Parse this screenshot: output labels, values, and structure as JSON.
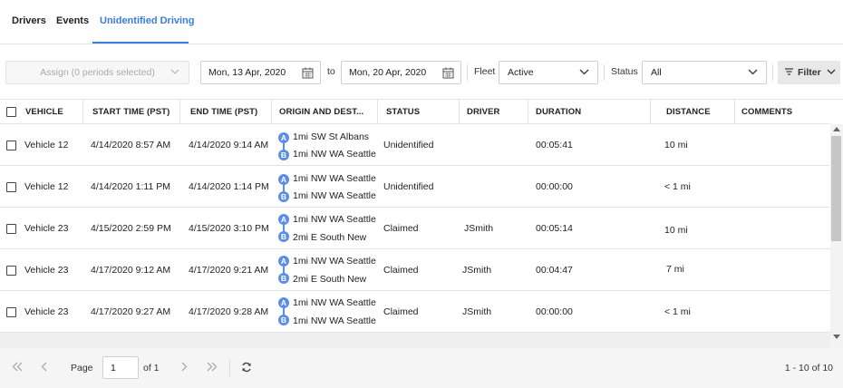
{
  "tabs": [
    {
      "label": "Drivers",
      "active": false
    },
    {
      "label": "Events",
      "active": false
    },
    {
      "label": "Unidentified Driving",
      "active": true
    }
  ],
  "toolbar": {
    "assign_label": "Assign (0 periods selected)",
    "start_date": "Mon, 13 Apr, 2020",
    "to_label": "to",
    "end_date": "Mon, 20 Apr, 2020",
    "fleet_label": "Fleet",
    "fleet_value": "Active",
    "status_label": "Status",
    "status_value": "All",
    "filter_label": "Filter"
  },
  "table": {
    "columns": [
      "VEHICLE",
      "START TIME (PST)",
      "END TIME (PST)",
      "ORIGIN AND DEST...",
      "STATUS",
      "DRIVER",
      "DURATION",
      "DISTANCE",
      "COMMENTS"
    ],
    "rows": [
      {
        "vehicle": "Vehicle 12",
        "start": "4/14/2020 8:57 AM",
        "end": "4/14/2020 9:14 AM",
        "origin": "1mi SW St Albans",
        "dest": "1mi NW WA Seattle",
        "status": "Unidentified",
        "driver": "",
        "duration": "00:05:41",
        "distance": "10 mi",
        "comments": ""
      },
      {
        "vehicle": "Vehicle 12",
        "start": "4/14/2020 1:11 PM",
        "end": "4/14/2020 1:14 PM",
        "origin": "1mi NW WA Seattle",
        "dest": "1mi NW WA Seattle",
        "status": "Unidentified",
        "driver": "",
        "duration": "00:00:00",
        "distance": "< 1 mi",
        "comments": ""
      },
      {
        "vehicle": "Vehicle 23",
        "start": "4/15/2020 2:59 PM",
        "end": "4/15/2020 3:10 PM",
        "origin": "1mi NW WA Seattle",
        "dest": "2mi E South New",
        "status": "Claimed",
        "driver": "JSmith",
        "duration": "00:05:14",
        "distance": "10 mi",
        "comments": ""
      },
      {
        "vehicle": "Vehicle 23",
        "start": "4/17/2020 9:12 AM",
        "end": "4/17/2020 9:21 AM",
        "origin": "1mi NW WA Seattle",
        "dest": "2mi E South New",
        "status": "Claimed",
        "driver": "JSmith",
        "duration": "00:04:47",
        "distance": "7 mi",
        "comments": ""
      },
      {
        "vehicle": "Vehicle 23",
        "start": "4/17/2020 9:27 AM",
        "end": "4/17/2020 9:28 AM",
        "origin": "1mi NW WA Seattle",
        "dest": "1mi NW WA Seattle",
        "status": "Claimed",
        "driver": "JSmith",
        "duration": "00:00:00",
        "distance": "< 1 mi",
        "comments": ""
      }
    ],
    "marker_a": "A",
    "marker_b": "B"
  },
  "pager": {
    "page_label": "Page",
    "page_value": "1",
    "of_label": "of 1",
    "range": "1 - 10 of 10"
  },
  "colors": {
    "accent": "#3b7dd8",
    "marker": "#5b8ee6"
  }
}
